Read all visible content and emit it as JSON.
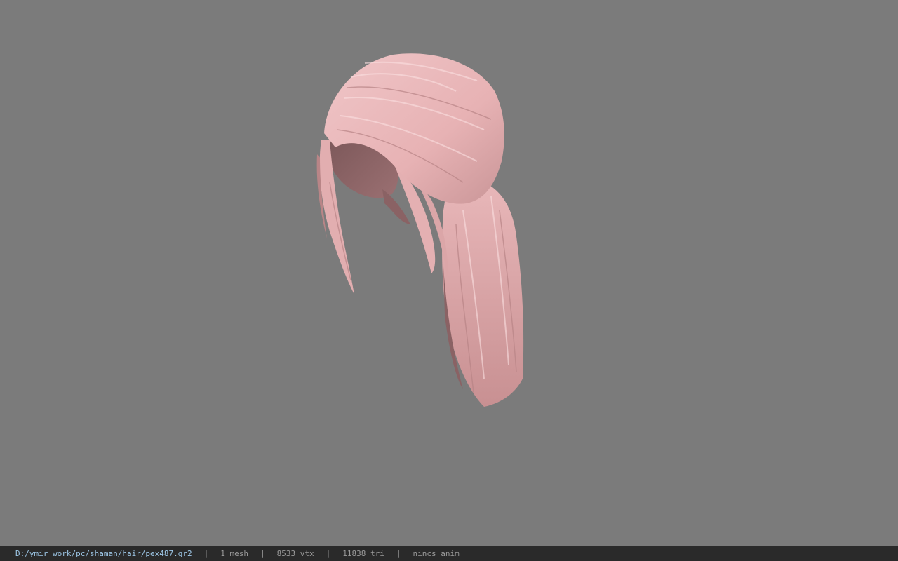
{
  "viewer": {
    "background_color": "#7b7b7b",
    "model_color": "#e8b4b6",
    "model_subject": "hair mesh"
  },
  "status_bar": {
    "file_path": "D:/ymir work/pc/shaman/hair/pex487.gr2",
    "separator": "|",
    "mesh_count": "1 mesh",
    "vertex_count": "8533 vtx",
    "triangle_count": "11838 tri",
    "anim_status": "nincs anim"
  }
}
